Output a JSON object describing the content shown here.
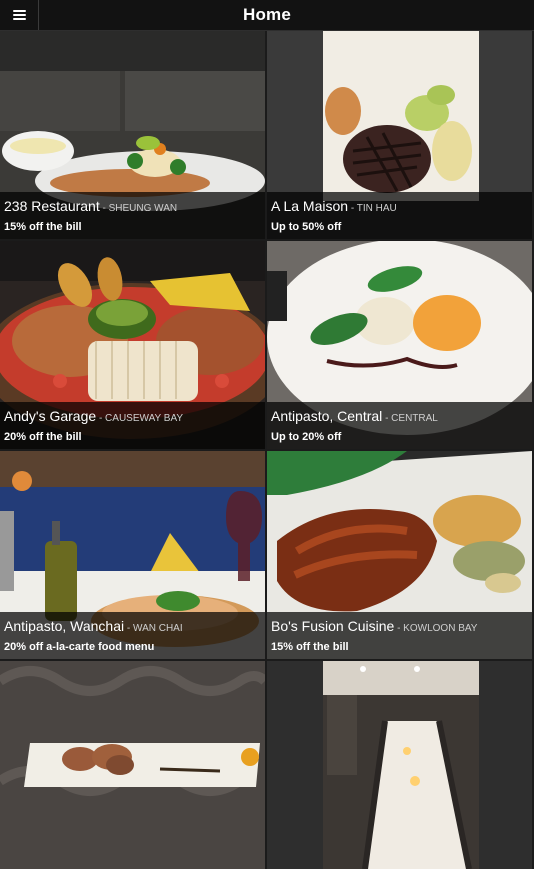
{
  "header": {
    "title": "Home",
    "menu_icon": "hamburger-icon"
  },
  "restaurants": [
    {
      "name": "238 Restaurant",
      "area": " - SHEUNG WAN",
      "offer": "15% off the bill"
    },
    {
      "name": "A La Maison",
      "area": " - TIN HAU",
      "offer": "Up to 50% off"
    },
    {
      "name": "Andy's Garage",
      "area": " - CAUSEWAY BAY",
      "offer": "20% off the bill"
    },
    {
      "name": "Antipasto, Central",
      "area": " - CENTRAL",
      "offer": "Up to 20% off"
    },
    {
      "name": "Antipasto, Wanchai",
      "area": " - WAN CHAI",
      "offer": "20% off a-la-carte food menu"
    },
    {
      "name": "Bo's Fusion Cuisine",
      "area": " - KOWLOON BAY",
      "offer": "15% off the bill"
    },
    {
      "name": "",
      "area": "",
      "offer": ""
    },
    {
      "name": "",
      "area": "",
      "offer": ""
    }
  ]
}
